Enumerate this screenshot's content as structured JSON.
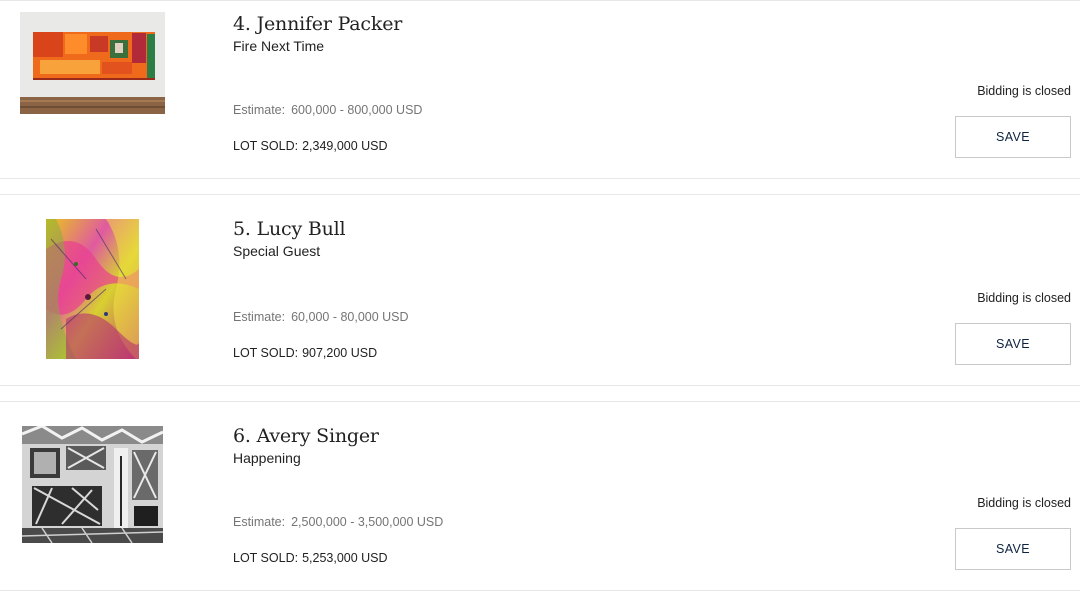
{
  "lots": [
    {
      "title": "4. Jennifer Packer",
      "subtitle": "Fire Next Time",
      "estimate_label": "Estimate:",
      "estimate_value": "600,000 - 800,000 USD",
      "sold_label": "LOT SOLD:",
      "sold_value": "2,349,000 USD",
      "status": "Bidding is closed",
      "save_label": "SAVE",
      "image_icon": "painting-thumbnail-orange-abstract"
    },
    {
      "title": "5. Lucy Bull",
      "subtitle": "Special Guest",
      "estimate_label": "Estimate:",
      "estimate_value": "60,000 - 80,000 USD",
      "sold_label": "LOT SOLD:",
      "sold_value": "907,200 USD",
      "status": "Bidding is closed",
      "save_label": "SAVE",
      "image_icon": "painting-thumbnail-multicolor-abstract"
    },
    {
      "title": "6. Avery Singer",
      "subtitle": "Happening",
      "estimate_label": "Estimate:",
      "estimate_value": "2,500,000 - 3,500,000 USD",
      "sold_label": "LOT SOLD:",
      "sold_value": "5,253,000 USD",
      "status": "Bidding is closed",
      "save_label": "SAVE",
      "image_icon": "painting-thumbnail-grayscale-figurative"
    }
  ],
  "colors": {
    "accent_text": "#0d2340",
    "muted_text": "#757575",
    "divider": "#e8e8e8"
  }
}
